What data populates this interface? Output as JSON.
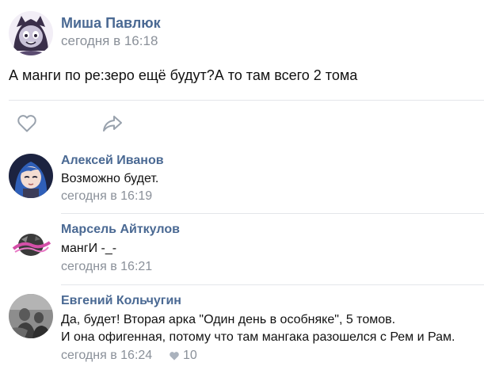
{
  "post": {
    "author": "Миша Павлюк",
    "date": "сегодня в 16:18",
    "text": "А манги по ре:зеро ещё будут?А то там всего 2 тома",
    "avatar_icon": "anime-character-avatar"
  },
  "actions": {
    "like_icon": "heart-icon",
    "share_icon": "share-arrow-icon"
  },
  "comments": [
    {
      "author": "Алексей Иванов",
      "text": "Возможно будет.",
      "date": "сегодня в 16:19",
      "avatar_icon": "anime-girl-avatar"
    },
    {
      "author": "Марсель Айткулов",
      "text": "мангИ -_-",
      "date": "сегодня в 16:21",
      "avatar_icon": "logo-avatar"
    },
    {
      "author": "Евгений Кольчугин",
      "text_line1": "Да, будет! Вторая арка \"Один день в особняке\", 5 томов.",
      "text_line2": "И она офигенная, потому что там мангака разошелся с Рем и Рам.",
      "date": "сегодня в 16:24",
      "likes": "10",
      "avatar_icon": "photo-avatar"
    }
  ],
  "colors": {
    "link": "#4a6993",
    "muted": "#8a9099",
    "divider": "#e4e6ea",
    "icon": "#99a2ad"
  }
}
